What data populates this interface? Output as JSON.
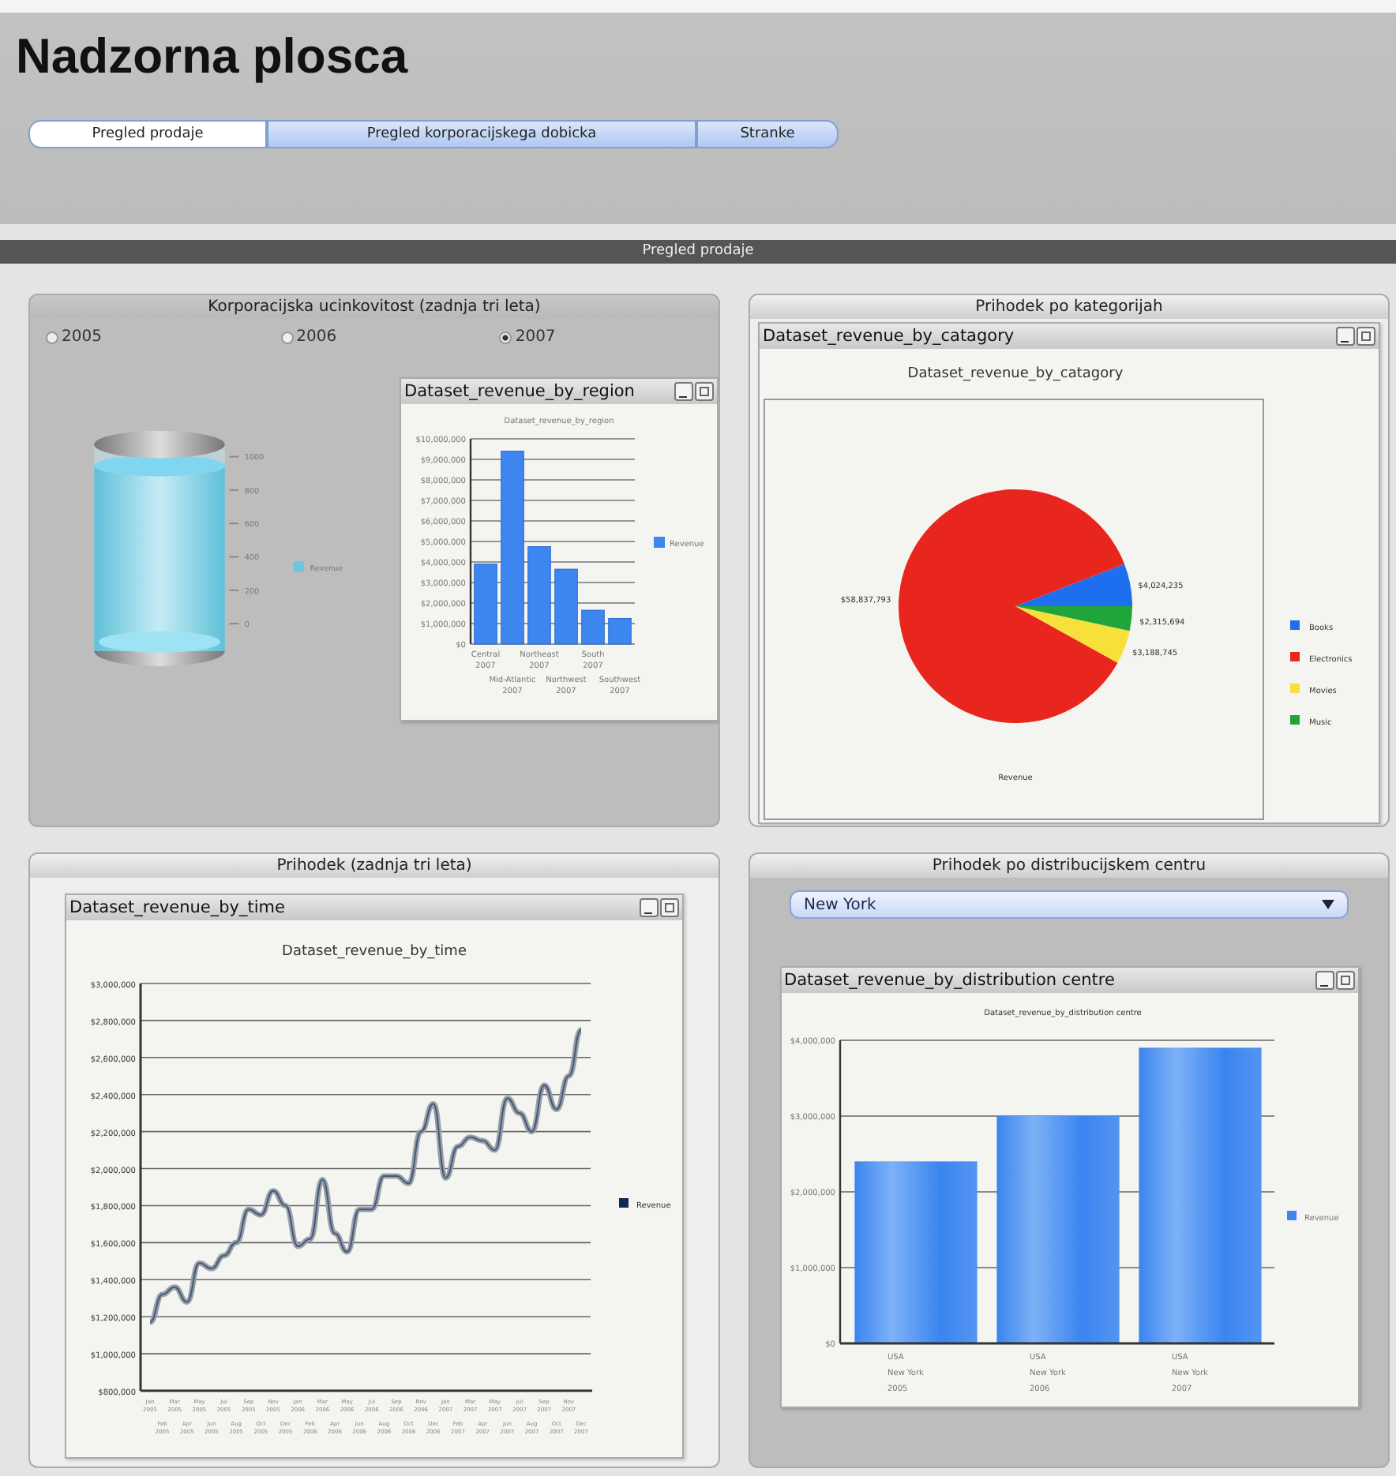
{
  "title": "Nadzorna plosca",
  "tabs": [
    {
      "label": "Pregled prodaje",
      "selected": true
    },
    {
      "label": "Pregled korporacijskega dobicka",
      "selected": false
    },
    {
      "label": "Stranke",
      "selected": false
    }
  ],
  "section_bar": "Pregled prodaje",
  "panels": [
    {
      "kind": "gauge_region",
      "title": "Korporacijska ucinkovitost  (zadnja tri leta)",
      "years": [
        {
          "label": "2005",
          "selected": false
        },
        {
          "label": "2006",
          "selected": false
        },
        {
          "label": "2007",
          "selected": true
        }
      ],
      "gauge": {
        "ticks": [
          "1000",
          "800",
          "600",
          "400",
          "200",
          "0"
        ],
        "legend": "Revenue"
      },
      "window": {
        "title": "Dataset_revenue_by_region",
        "chart_data": {
          "type": "bar",
          "title": "Dataset_revenue_by_region",
          "grid": true,
          "legend": "right",
          "categories": [
            "Central\n2007",
            "Mid-Atlantic\n2007",
            "Northeast\n2007",
            "Northwest\n2007",
            "South\n2007",
            "Southwest\n2007"
          ],
          "series": [
            {
              "name": "Revenue",
              "color": "#3d86f0",
              "values": [
                3900000,
                9400000,
                4750000,
                3650000,
                1650000,
                1250000
              ]
            }
          ],
          "ylim": [
            0,
            10000000
          ],
          "yticks": [
            {
              "value": 0,
              "label": "$0"
            },
            {
              "value": 1000000,
              "label": "$1,000,000"
            },
            {
              "value": 2000000,
              "label": "$2,000,000"
            },
            {
              "value": 3000000,
              "label": "$3,000,000"
            },
            {
              "value": 4000000,
              "label": "$4,000,000"
            },
            {
              "value": 5000000,
              "label": "$5,000,000"
            },
            {
              "value": 6000000,
              "label": "$6,000,000"
            },
            {
              "value": 7000000,
              "label": "$7,000,000"
            },
            {
              "value": 8000000,
              "label": "$8,000,000"
            },
            {
              "value": 9000000,
              "label": "$9,000,000"
            },
            {
              "value": 10000000,
              "label": "$10,000,000"
            }
          ]
        }
      }
    },
    {
      "kind": "pie",
      "title": "Prihodek po kategorijah",
      "window": {
        "title": "Dataset_revenue_by_catagory",
        "chart_data": {
          "type": "pie",
          "title": "Dataset_revenue_by_catagory",
          "legend": "right",
          "categories": [
            "Books",
            "Electronics",
            "Movies",
            "Music"
          ],
          "series": [
            {
              "name": "Revenue",
              "values": [
                5.886,
                86.063,
                4.664,
                3.387
              ]
            }
          ],
          "colors": [
            "#1e6ef0",
            "#e8261e",
            "#f7e03a",
            "#1fa53a"
          ],
          "value_labels": [
            "$4,024,235",
            "$58,837,793",
            "$3,188,745",
            "$2,315,694"
          ]
        }
      }
    },
    {
      "kind": "line",
      "title": "Prihodek (zadnja tri leta)",
      "window": {
        "title": "Dataset_revenue_by_time",
        "chart_data": {
          "type": "line",
          "title": "Dataset_revenue_by_time",
          "grid": true,
          "legend": "right",
          "categories": [
            "Jan\n2005",
            "Feb\n2005",
            "Mar\n2005",
            "Apr\n2005",
            "May\n2005",
            "Jun\n2005",
            "Jul\n2005",
            "Aug\n2005",
            "Sep\n2005",
            "Oct\n2005",
            "Nov\n2005",
            "Dec\n2005",
            "Jan\n2006",
            "Feb\n2006",
            "Mar\n2006",
            "Apr\n2006",
            "May\n2006",
            "Jun\n2006",
            "Jul\n2006",
            "Aug\n2006",
            "Sep\n2006",
            "Oct\n2006",
            "Nov\n2006",
            "Dec\n2006",
            "Jan\n2007",
            "Feb\n2007",
            "Mar\n2007",
            "Apr\n2007",
            "May\n2007",
            "Jun\n2007",
            "Jul\n2007",
            "Aug\n2007",
            "Sep\n2007",
            "Oct\n2007",
            "Nov\n2007",
            "Dec\n2007"
          ],
          "series": [
            {
              "name": "Revenue",
              "color": "#0d2a55",
              "values": [
                1170000,
                1320000,
                1360000,
                1280000,
                1490000,
                1460000,
                1530000,
                1600000,
                1780000,
                1750000,
                1880000,
                1800000,
                1580000,
                1620000,
                1940000,
                1650000,
                1550000,
                1780000,
                1780000,
                1960000,
                1960000,
                1920000,
                2200000,
                2350000,
                1950000,
                2120000,
                2170000,
                2150000,
                2100000,
                2380000,
                2300000,
                2200000,
                2450000,
                2320000,
                2500000,
                2750000
              ]
            }
          ],
          "ylim": [
            800000,
            3000000
          ],
          "yticks": [
            {
              "value": 800000,
              "label": "$800,000"
            },
            {
              "value": 1000000,
              "label": "$1,000,000"
            },
            {
              "value": 1200000,
              "label": "$1,200,000"
            },
            {
              "value": 1400000,
              "label": "$1,400,000"
            },
            {
              "value": 1600000,
              "label": "$1,600,000"
            },
            {
              "value": 1800000,
              "label": "$1,800,000"
            },
            {
              "value": 2000000,
              "label": "$2,000,000"
            },
            {
              "value": 2200000,
              "label": "$2,200,000"
            },
            {
              "value": 2400000,
              "label": "$2,400,000"
            },
            {
              "value": 2600000,
              "label": "$2,600,000"
            },
            {
              "value": 2800000,
              "label": "$2,800,000"
            },
            {
              "value": 3000000,
              "label": "$3,000,000"
            }
          ]
        }
      }
    },
    {
      "kind": "bar",
      "title": "Prihodek po distribucijskem centru",
      "dropdown": {
        "value": "New York"
      },
      "window": {
        "title": "Dataset_revenue_by_distribution centre",
        "chart_data": {
          "type": "bar",
          "title": "Dataset_revenue_by_distribution centre",
          "grid": true,
          "legend": "right",
          "categories": [
            "USA\nNew York\n2005",
            "USA\nNew York\n2006",
            "USA\nNew York\n2007"
          ],
          "series": [
            {
              "name": "Revenue",
              "color": "#3d86f0",
              "values": [
                2400000,
                3000000,
                3900000
              ]
            }
          ],
          "ylim": [
            0,
            4000000
          ],
          "yticks": [
            {
              "value": 0,
              "label": "$0"
            },
            {
              "value": 1000000,
              "label": "$1,000,000"
            },
            {
              "value": 2000000,
              "label": "$2,000,000"
            },
            {
              "value": 3000000,
              "label": "$3,000,000"
            },
            {
              "value": 4000000,
              "label": "$4,000,000"
            }
          ]
        }
      }
    }
  ]
}
